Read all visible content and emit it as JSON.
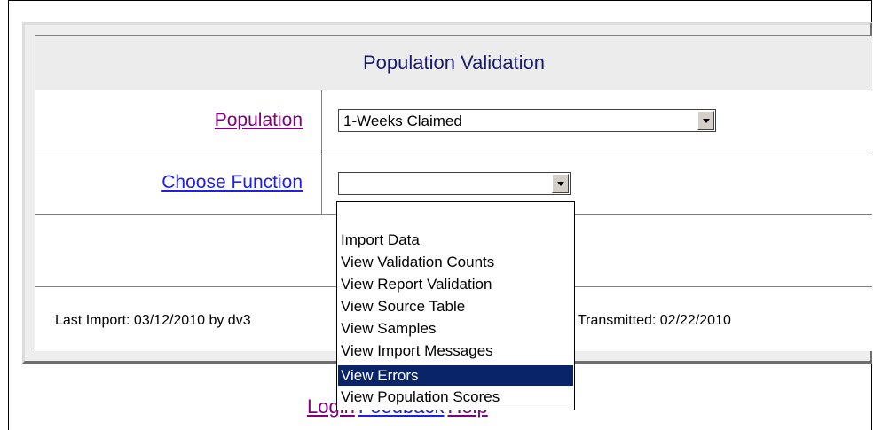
{
  "header": {
    "title": "Population Validation"
  },
  "population": {
    "label": "Population",
    "selected": "1-Weeks Claimed"
  },
  "function": {
    "label": "Choose Function",
    "selected": "",
    "options": [
      "Import Data",
      "View Validation Counts",
      "View Report Validation",
      "View Source Table",
      "View Samples",
      "View Import Messages",
      "View Errors",
      "View Population Scores"
    ],
    "highlighted": "View Errors"
  },
  "footer": {
    "last_import": "Last Import: 03/12/2010 by dv3",
    "transmitted": "Transmitted: 02/22/2010"
  },
  "links": {
    "login": "Login",
    "feedback": "Feedback",
    "help": "Help"
  },
  "colors": {
    "header_text": "#1a1a6e",
    "visited_link": "#800080",
    "link": "#1f1fe6",
    "selection": "#0a246a"
  }
}
